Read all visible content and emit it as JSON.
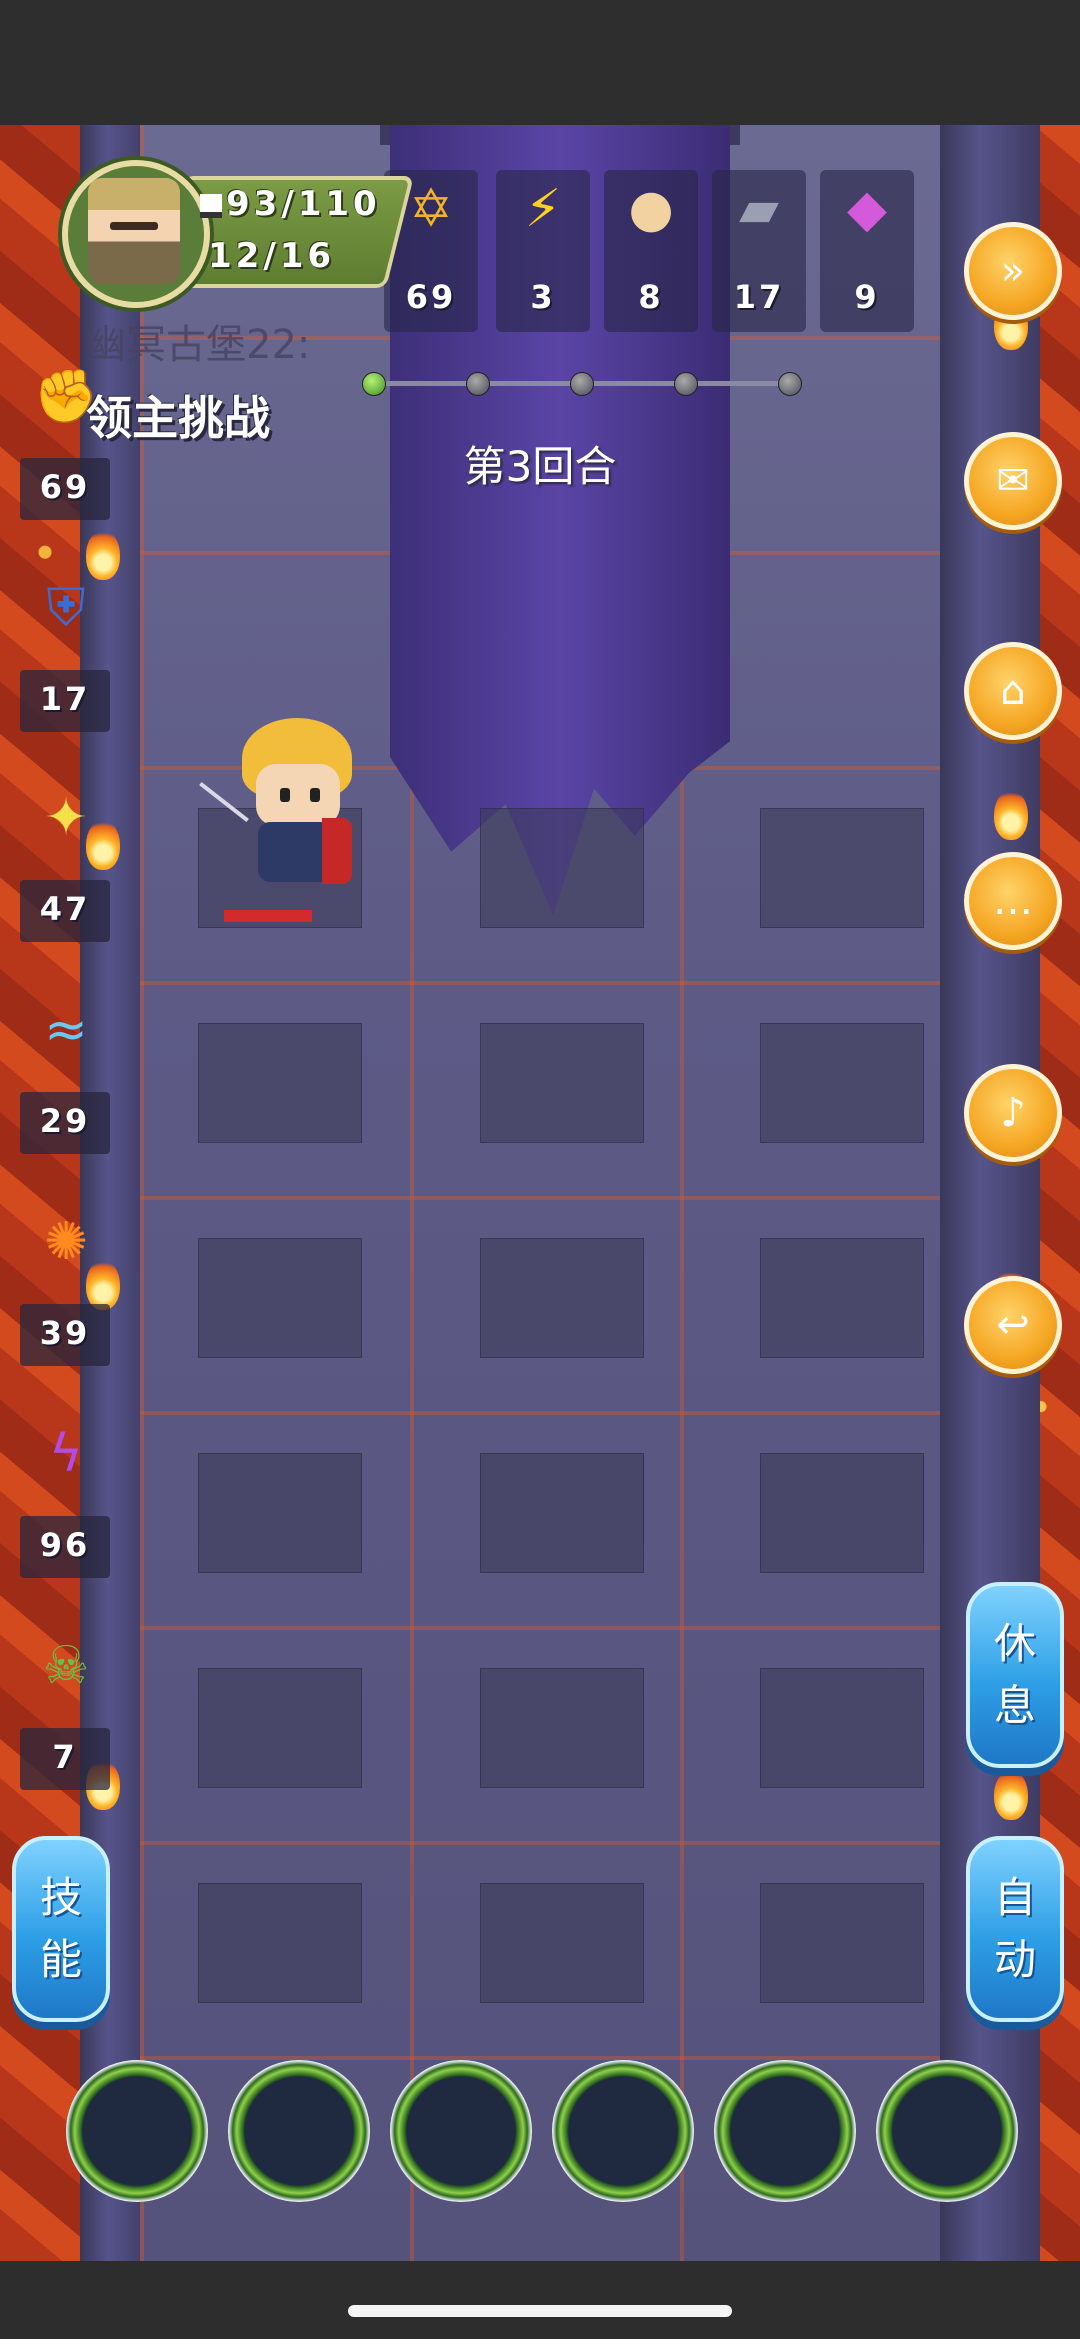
{
  "hud": {
    "hp": "93/110",
    "mp": "12/16"
  },
  "resources": [
    {
      "name": "gold",
      "icon": "gold-coin-icon",
      "glyph": "✡",
      "value": "69",
      "color": "#f0b428"
    },
    {
      "name": "energy",
      "icon": "lightning-icon",
      "glyph": "⚡",
      "value": "3",
      "color": "#ffd21e"
    },
    {
      "name": "bun",
      "icon": "bun-icon",
      "glyph": "●",
      "value": "8",
      "color": "#f1d2a0"
    },
    {
      "name": "iron",
      "icon": "iron-ingot-icon",
      "glyph": "▰",
      "value": "17",
      "color": "#9aa0b2"
    },
    {
      "name": "crystal",
      "icon": "crystal-icon",
      "glyph": "◆",
      "value": "9",
      "color": "#d45ad9"
    }
  ],
  "stage": {
    "location_faded": "幽冥古堡22:",
    "title": "领主挑战",
    "round_label": "第3回合",
    "progress": {
      "total": 5,
      "current": 1
    }
  },
  "stats": [
    {
      "icon": "fist-attack-icon",
      "glyph": "✊",
      "value": "69",
      "color": "#c98a4a"
    },
    {
      "icon": "shield-icon",
      "glyph": "⛨",
      "value": "17",
      "color": "#3a6cd1"
    },
    {
      "icon": "holy-light-icon",
      "glyph": "✦",
      "value": "47",
      "color": "#f4e04a"
    },
    {
      "icon": "water-wave-icon",
      "glyph": "≈",
      "value": "29",
      "color": "#6ac8f2"
    },
    {
      "icon": "fire-orb-icon",
      "glyph": "✺",
      "value": "39",
      "color": "#ff8a1e"
    },
    {
      "icon": "lightning-bolt-icon",
      "glyph": "ϟ",
      "value": "96",
      "color": "#b44ae8"
    },
    {
      "icon": "poison-icon",
      "glyph": "☠",
      "value": "7",
      "color": "#6abf4a"
    }
  ],
  "side_buttons": [
    {
      "name": "fast-forward-button",
      "icon": "fast-forward-icon",
      "glyph": "»"
    },
    {
      "name": "mail-button",
      "icon": "envelope-icon",
      "glyph": "✉"
    },
    {
      "name": "home-button",
      "icon": "home-icon",
      "glyph": "⌂"
    },
    {
      "name": "chat-button",
      "icon": "chat-bubble-icon",
      "glyph": "…"
    },
    {
      "name": "sound-button",
      "icon": "speaker-icon",
      "glyph": "♪"
    },
    {
      "name": "return-button",
      "icon": "return-arrow-icon",
      "glyph": "↩"
    }
  ],
  "buttons": {
    "rest": [
      "休",
      "息"
    ],
    "auto": [
      "自",
      "动"
    ],
    "skill": [
      "技",
      "能"
    ]
  },
  "slots_count": 6,
  "colors": {
    "accent_orange": "#f5a623",
    "accent_blue": "#2d9fe6",
    "lava": "#c9401b"
  }
}
